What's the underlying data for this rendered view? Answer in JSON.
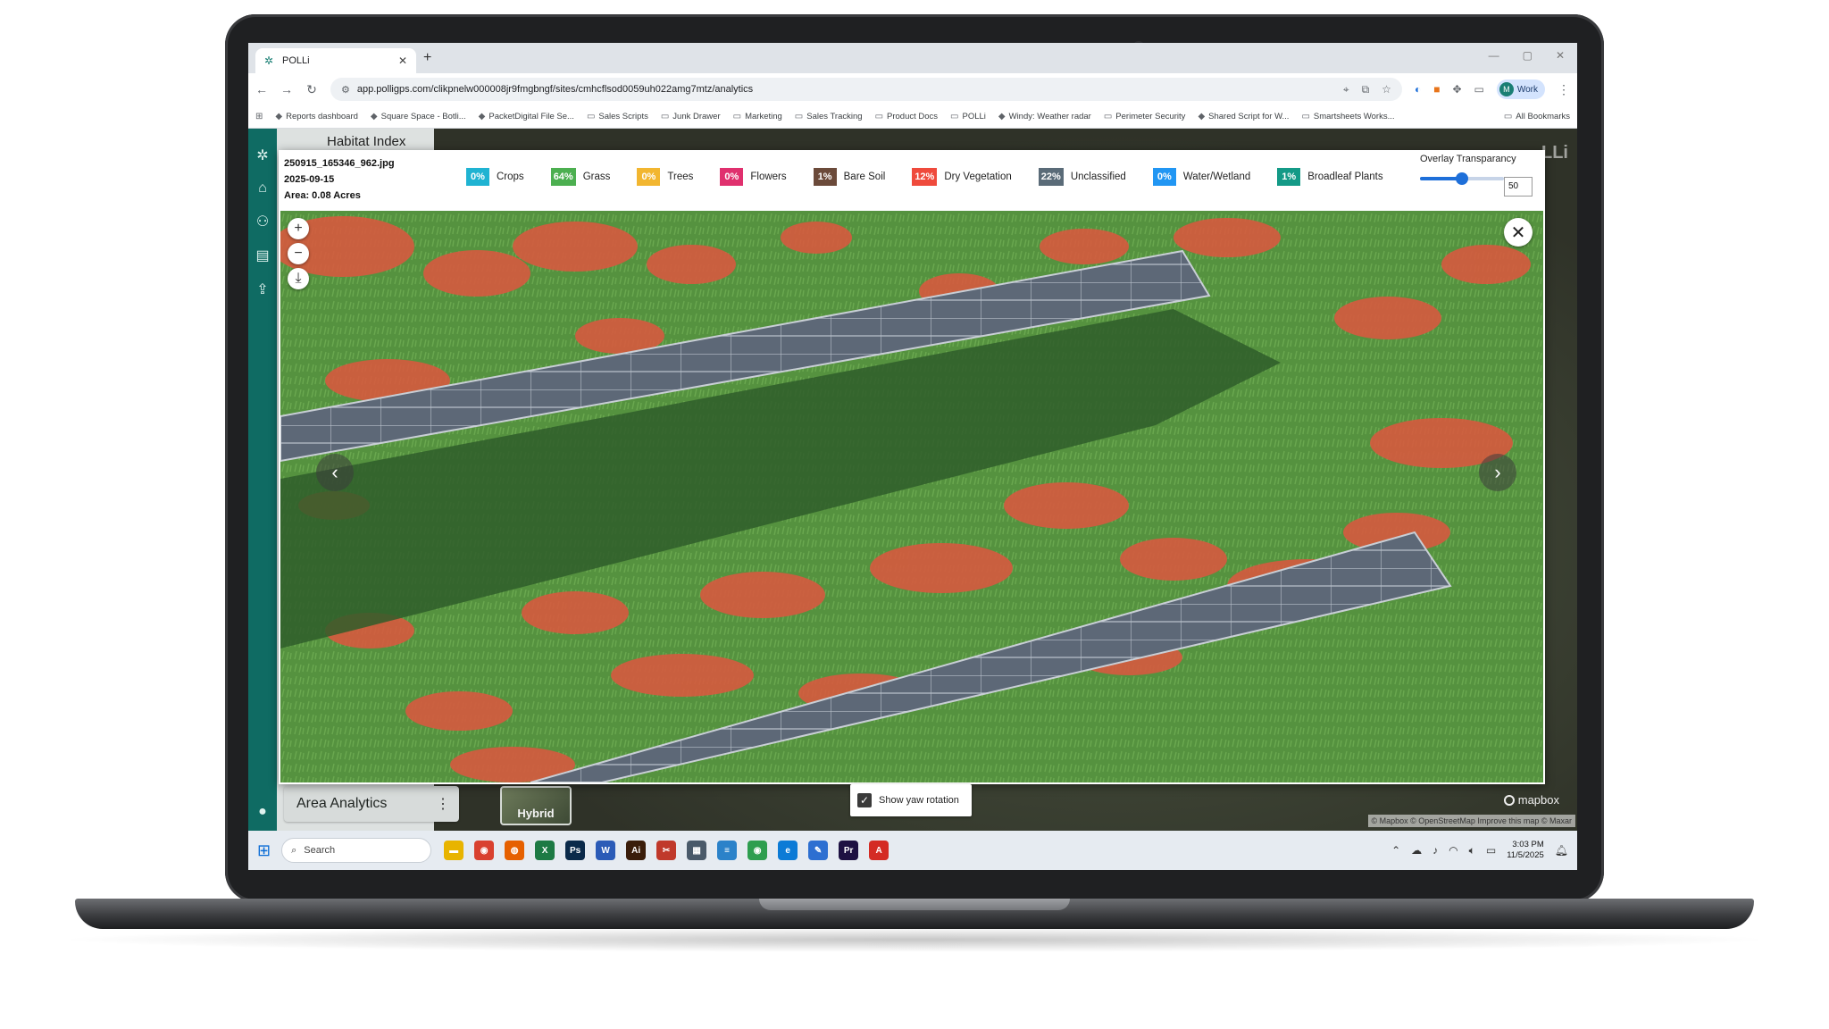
{
  "browser": {
    "tab_title": "POLLi",
    "url": "app.polligps.com/clikpnelw000008jr9fmgbngf/sites/cmhcflsod0059uh022amg7mtz/analytics",
    "profile_label": "Work",
    "bookmarks": [
      {
        "label": "Reports dashboard",
        "icon": "chart-icon"
      },
      {
        "label": "Square Space - Botli...",
        "icon": "square-icon"
      },
      {
        "label": "PacketDigital File Se...",
        "icon": "file-icon"
      },
      {
        "label": "Sales Scripts",
        "icon": "folder-icon"
      },
      {
        "label": "Junk Drawer",
        "icon": "folder-icon"
      },
      {
        "label": "Marketing",
        "icon": "folder-icon"
      },
      {
        "label": "Sales Tracking",
        "icon": "folder-icon"
      },
      {
        "label": "Product Docs",
        "icon": "folder-icon"
      },
      {
        "label": "POLLi",
        "icon": "folder-icon"
      },
      {
        "label": "Windy: Weather radar",
        "icon": "windy-icon"
      },
      {
        "label": "Perimeter Security",
        "icon": "folder-icon"
      },
      {
        "label": "Shared Script for W...",
        "icon": "script-icon"
      },
      {
        "label": "Smartsheets Works...",
        "icon": "folder-icon"
      }
    ],
    "all_bookmarks": "All Bookmarks"
  },
  "app": {
    "panel_header": "Habitat Index",
    "area_card_title": "Area Analytics",
    "hybrid_label": "Hybrid",
    "mapbox_label": "mapbox",
    "attribution": "© Mapbox © OpenStreetMap  Improve this map © Maxar",
    "brand_mark": "LLi"
  },
  "modal": {
    "filename": "250915_165346_962.jpg",
    "date": "2025-09-15",
    "area": "Area: 0.08 Acres",
    "legend": [
      {
        "pct": "0%",
        "label": "Crops",
        "color": "#1fb3d2"
      },
      {
        "pct": "64%",
        "label": "Grass",
        "color": "#4caf50"
      },
      {
        "pct": "0%",
        "label": "Trees",
        "color": "#f2b630"
      },
      {
        "pct": "0%",
        "label": "Flowers",
        "color": "#e0306e"
      },
      {
        "pct": "1%",
        "label": "Bare Soil",
        "color": "#6b4a3a"
      },
      {
        "pct": "12%",
        "label": "Dry Vegetation",
        "color": "#ef4a3c"
      },
      {
        "pct": "22%",
        "label": "Unclassified",
        "color": "#5a6b78"
      },
      {
        "pct": "0%",
        "label": "Water/Wetland",
        "color": "#2196f3"
      },
      {
        "pct": "1%",
        "label": "Broadleaf Plants",
        "color": "#149a87"
      }
    ],
    "overlay_label": "Overlay Transparancy",
    "overlay_value": "50",
    "overlay_fraction": 0.5,
    "yaw_label": "Show yaw rotation",
    "yaw_checked": true
  },
  "taskbar": {
    "search_placeholder": "Search",
    "time": "3:03 PM",
    "date": "11/5/2025",
    "apps": [
      {
        "name": "file-explorer-icon",
        "glyph": "▬",
        "color": "#e8b400"
      },
      {
        "name": "chrome-icon",
        "glyph": "◉",
        "color": "#d9412f"
      },
      {
        "name": "firefox-icon",
        "glyph": "◍",
        "color": "#e66000"
      },
      {
        "name": "excel-icon",
        "glyph": "X",
        "color": "#1d7a44"
      },
      {
        "name": "photoshop-icon",
        "glyph": "Ps",
        "color": "#0b2a4a"
      },
      {
        "name": "word-icon",
        "glyph": "W",
        "color": "#2b5bb7"
      },
      {
        "name": "illustrator-icon",
        "glyph": "Ai",
        "color": "#3a1d0a"
      },
      {
        "name": "snipping-icon",
        "glyph": "✂",
        "color": "#c0392b"
      },
      {
        "name": "calculator-icon",
        "glyph": "▦",
        "color": "#4a5a6a"
      },
      {
        "name": "notepad-icon",
        "glyph": "≡",
        "color": "#2b82c9"
      },
      {
        "name": "chrome-2-icon",
        "glyph": "◉",
        "color": "#2e9e4f"
      },
      {
        "name": "edge-icon",
        "glyph": "e",
        "color": "#0c7bd6"
      },
      {
        "name": "paint-icon",
        "glyph": "✎",
        "color": "#2d6fd1"
      },
      {
        "name": "premiere-icon",
        "glyph": "Pr",
        "color": "#1e1142"
      },
      {
        "name": "acrobat-icon",
        "glyph": "A",
        "color": "#d42b24"
      }
    ]
  }
}
